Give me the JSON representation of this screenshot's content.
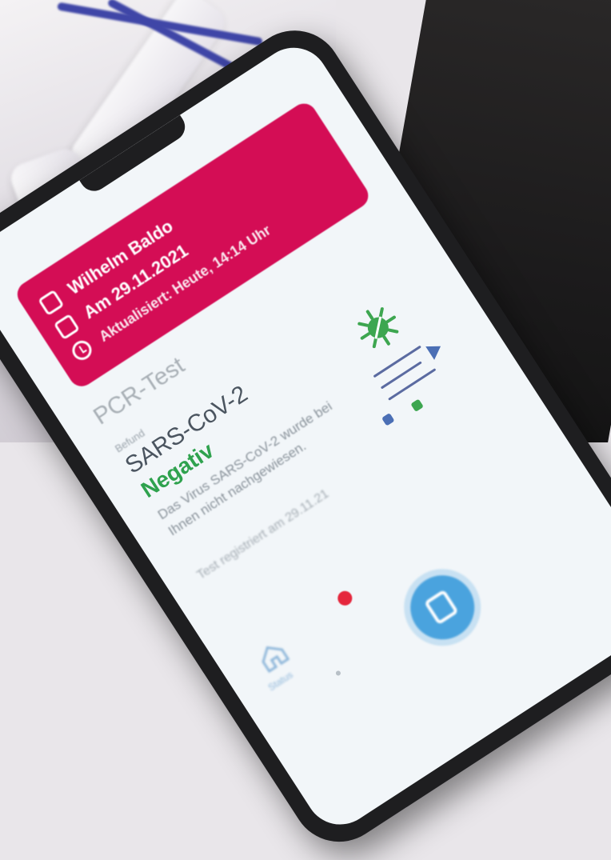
{
  "red_card": {
    "name": "Wilhelm Baldo",
    "date": "Am 29.11.2021",
    "updated": "Aktualisiert: Heute, 14:14 Uhr",
    "calendar_icon": "calendar-icon",
    "refresh_icon": "refresh-icon"
  },
  "test": {
    "type": "PCR-Test",
    "label": "Befund",
    "pathogen": "SARS-CoV-2",
    "result": "Negativ",
    "description": "Das Virus SARS-CoV-2 wurde bei Ihnen nicht nachgewiesen.",
    "registered": "Test registriert am 29.11.21"
  },
  "nav": {
    "home_label": "Status",
    "fab_icon": "scan-icon",
    "badge_color": "#e5263c"
  },
  "colors": {
    "accent_red": "#d40d55",
    "negative_green": "#2fa24e",
    "fab_blue": "#4aa3de"
  }
}
